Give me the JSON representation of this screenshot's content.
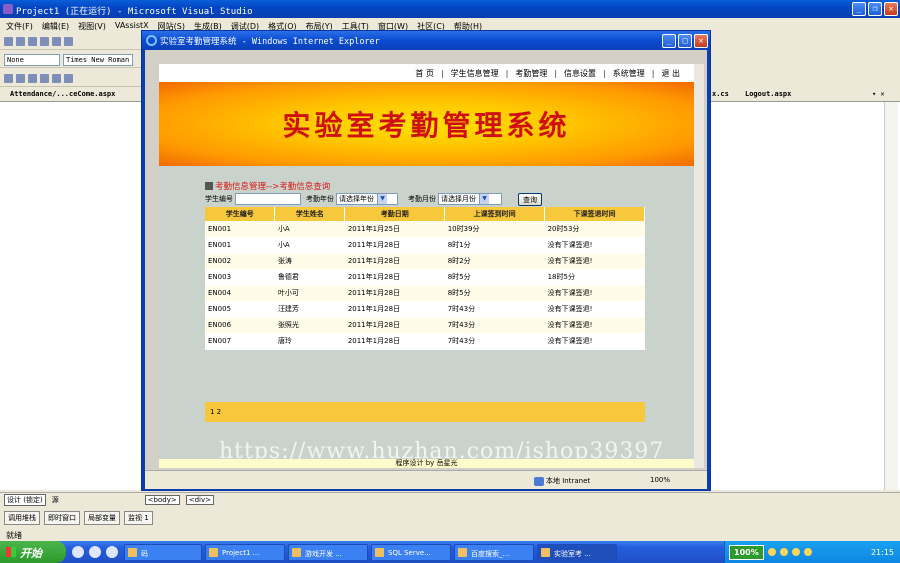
{
  "vs": {
    "title": "Project1 (正在运行) - Microsoft Visual Studio",
    "menu": [
      "文件(F)",
      "编辑(E)",
      "视图(V)",
      "VAssistX",
      "网站(S)",
      "生成(B)",
      "调试(D)",
      "格式(O)",
      "布局(Y)",
      "工具(T)",
      "窗口(W)",
      "社区(C)",
      "帮助(H)"
    ],
    "style_select": "None",
    "font_select": "Times New Roman",
    "doc_tab_left": "Attendance/...ceCome.aspx",
    "doc_tab_mid": "x.cs",
    "doc_tab_right": "Logout.aspx",
    "design_tab": "设计 (锁定)",
    "source_tab": "源",
    "tag_body": "<body>",
    "tag_div": "<div>",
    "bottom_tabs": [
      "调用堆栈",
      "即时窗口",
      "局部变量",
      "监视 1"
    ],
    "status": "就绪"
  },
  "ie": {
    "title": "实验室考勤管理系统 - Windows Internet Explorer",
    "zone": "本地 Intranet",
    "zoom": "100%"
  },
  "page": {
    "nav": [
      "首 页",
      "学生信息管理",
      "考勤管理",
      "信息设置",
      "系统管理",
      "退 出"
    ],
    "banner_title": "实验室考勤管理系统",
    "breadcrumb": "考勤信息管理-->考勤信息查询",
    "labels": {
      "student_no": "学生编号",
      "year": "考勤年份",
      "month": "考勤月份"
    },
    "year_select": "请选择年份",
    "month_select": "请选择月份",
    "search_button": "查询",
    "columns": [
      "学生编号",
      "学生姓名",
      "考勤日期",
      "上课签到时间",
      "下课签退时间"
    ],
    "rows": [
      [
        "EN001",
        "小A",
        "2011年1月25日",
        "10时39分",
        "20时53分"
      ],
      [
        "EN001",
        "小A",
        "2011年1月28日",
        "8时1分",
        "没有下课签退!"
      ],
      [
        "EN002",
        "张涛",
        "2011年1月28日",
        "8时2分",
        "没有下课签退!"
      ],
      [
        "EN003",
        "鲁德君",
        "2011年1月28日",
        "8时5分",
        "18时5分"
      ],
      [
        "EN004",
        "叶小可",
        "2011年1月28日",
        "8时5分",
        "没有下课签退!"
      ],
      [
        "EN005",
        "汪建芳",
        "2011年1月28日",
        "7时43分",
        "没有下课签退!"
      ],
      [
        "EN006",
        "张照光",
        "2011年1月28日",
        "7时43分",
        "没有下课签退!"
      ],
      [
        "EN007",
        "唐玲",
        "2011年1月28日",
        "7时43分",
        "没有下课签退!"
      ]
    ],
    "pager": "1 2",
    "watermark": "https://www.huzhan.com/ishop39397",
    "footer": "程序设计 by 岳星光"
  },
  "taskbar": {
    "start": "开始",
    "tasks": [
      "码",
      "Project1 ...",
      "游戏开发 ...",
      "SQL Serve...",
      "百度搜索_...",
      "实验室考 ..."
    ],
    "zoom_badge": "100%",
    "clock": "21:15"
  }
}
